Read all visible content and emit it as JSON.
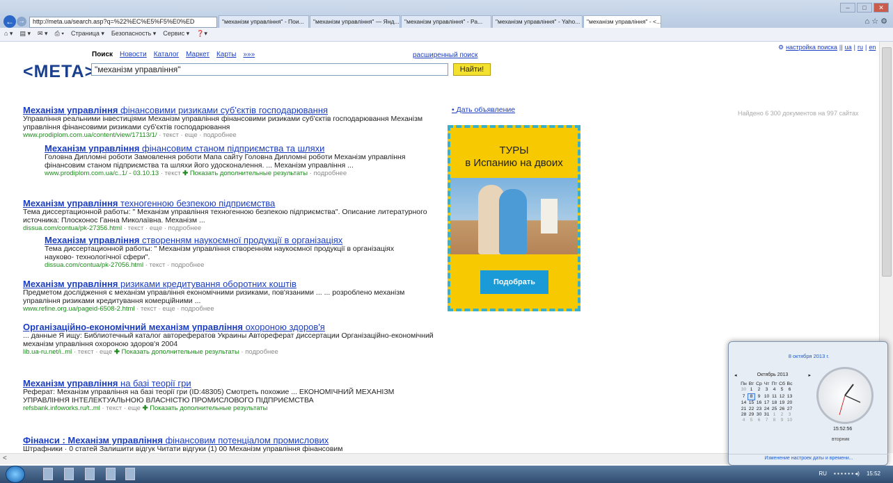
{
  "browser": {
    "address": "http://meta.ua/search.asp?q=%22%EC%E5%F5%E0%ED",
    "tabs": [
      "\"механізм управління\" - Пои...",
      "\"механізм управління\" — Янд...",
      "\"механізм управління\" - Ра...",
      "\"механізм управління\" - Yaho...",
      "\"механізм управління\" - <..."
    ],
    "toolbar": [
      "Страница ▾",
      "Безопасность ▾",
      "Сервис ▾"
    ]
  },
  "header": {
    "logo": "<META>",
    "nav": [
      "Поиск",
      "Новости",
      "Каталог",
      "Маркет",
      "Карты",
      "»»»"
    ],
    "advanced": "расширенный поиск",
    "query": "\"механізм управління\"",
    "button": "Найти!",
    "settings": [
      "настройка поиска",
      "||",
      "ua",
      "|",
      "ru",
      "|",
      "en"
    ],
    "found": "Найдено 6 300 документов на 997 сайтах"
  },
  "results": [
    {
      "title_b": "Механізм управління",
      "title_r": " фінансовими ризиками суб'єктів господарювання",
      "desc": "Управління реальними інвестиціями Механізм управління фінансовими ризиками суб'єктів господарювання Механізм управління фінансовими ризиками суб'єктів господарювання",
      "url": "www.prodiplom.com.ua/content/view/17113/1/",
      "meta": " · текст · еще · подробнее"
    },
    {
      "title_b": "Механізм управління",
      "title_r": " фінансовим станом підприємства та шляхи",
      "desc": "Головна Дипломні роботи Замовлення роботи Мапа сайту Головна Дипломні роботи Механізм управління фінансовим станом підприємства та шляхи його удосконалення. ... Механізм управління ...",
      "url": "www.prodiplom.com.ua/c..1/ - 03.10.13",
      "meta": " · текст",
      "more": "Показать дополнительные результаты",
      "tail": " · подробнее"
    },
    {
      "title_b": "Механізм управління",
      "title_r": " техногенною безпекою підприємства",
      "desc": "Тема диссертационной работы: \" Механізм управління техногенною безпекою підприємства\". Описание литературного источника: Плосконос Ганна Миколаївна. Механізм ...",
      "url": "dissua.com/contua/pk-27356.html",
      "meta": " · текст · еще · подробнее"
    },
    {
      "title_b": "Механізм управління",
      "title_r": " створенням наукоємної продукції в організаціях",
      "desc": "Тема диссертационной работы: \" Механізм управління створенням наукоємної продукції в організаціях науково- технологічної сфери\".",
      "url": "dissua.com/contua/pk-27056.html",
      "meta": " · текст · подробнее"
    },
    {
      "title_b": "Механізм управління",
      "title_r": " ризиками кредитування оборотних коштів",
      "desc": "Предметом дослідження є механізм управління економічними ризиками, пов'язаними ... ... розроблено механізм управління ризиками кредитування комерційними ...",
      "url": "www.refine.org.ua/pageid-6508-2.html",
      "meta": " · текст · еще · подробнее"
    },
    {
      "title_b": "Організаційно-економічний механізм управління",
      "title_r": " охороною здоров'я",
      "desc": "... данные Я ищу: Библиотечный каталог авторефератов Украины Автореферат диссертации Організаційно-економічний механізм управління охороною здоров'я 2004",
      "url": "lib.ua-ru.net/i..ml",
      "meta": " · текст · еще",
      "more": "Показать дополнительные результаты",
      "tail": " · подробнее"
    },
    {
      "title_b": "Механізм управління",
      "title_r": " на базі теорії гри",
      "desc": "Реферат: Механізм управління на базі теорії гри (ID:48305) Смотреть похожие ... ЕКОНОМІЧНИЙ МЕХАНІЗМ УПРАВЛІННЯ ІНТЕЛЕКТУАЛЬНОЮ ВЛАСНІСТЮ ПРОМИСЛОВОГО ПІДПРИЄМСТВА",
      "url": "refsbank.infoworks.ru/t..ml",
      "meta": " · текст · еще",
      "more": "Показать дополнительные результаты"
    },
    {
      "title_b": "Фінанси : Механізм управління",
      "title_r": " фінансовим потенціалом промислових",
      "desc": "Штрафники · 0 статей Залишити відгук Читати відгуки (1) 00 Механізм управління фінансовим",
      "url": "",
      "meta": ""
    }
  ],
  "ad": {
    "link": "Дать объявление",
    "title1": "ТУРЫ",
    "title2": "в Испанию на двоих",
    "button": "Подобрать"
  },
  "calendar": {
    "date": "8 октября 2013 г.",
    "month": "Октябрь 2013",
    "days": [
      "Пн",
      "Вт",
      "Ср",
      "Чт",
      "Пт",
      "Сб",
      "Вс"
    ],
    "time": "15:52:56",
    "weekday": "вторник",
    "link": "Изменение настроек даты и времени..."
  },
  "tray": {
    "lang": "RU",
    "time": "15:52"
  }
}
